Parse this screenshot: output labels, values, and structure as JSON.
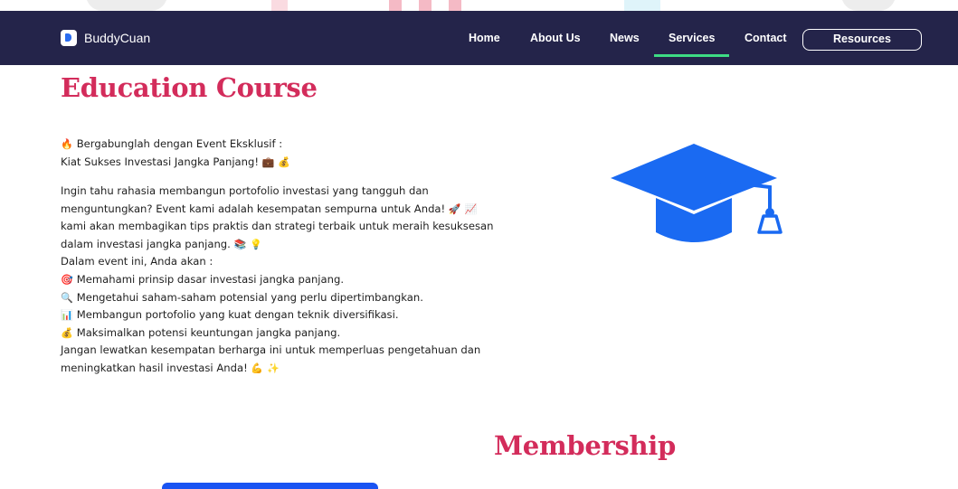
{
  "colors": {
    "nav_bg": "#24244a",
    "accent_pink": "#d32c5b",
    "active_underline": "#3ddc84",
    "cap_blue": "#1a6af2"
  },
  "brand": {
    "name": "BuddyCuan",
    "icon": "brand-logo-icon"
  },
  "nav": {
    "home": "Home",
    "about": "About Us",
    "news": "News",
    "services": "Services",
    "contact": "Contact",
    "resources": "Resources",
    "active": "Services"
  },
  "education": {
    "title": "Education Course",
    "intro_line1": "Bergabunglah dengan Event Eksklusif :",
    "intro_line2": "Kiat Sukses Investasi Jangka Panjang!",
    "body_line1": "Ingin tahu rahasia membangun portofolio investasi yang tangguh dan",
    "body_line2": "menguntungkan? Event kami adalah kesempatan sempurna untuk Anda!",
    "body_line3": "kami akan membagikan tips praktis dan strategi terbaik untuk meraih kesuksesan",
    "body_line4": "dalam investasi jangka panjang.",
    "body_line5": "Dalam event ini, Anda akan :",
    "point1": "Memahami prinsip dasar investasi jangka panjang.",
    "point2": "Mengetahui saham-saham potensial yang perlu dipertimbangkan.",
    "point3": "Membangun portofolio yang kuat dengan teknik diversifikasi.",
    "point4": "Maksimalkan potensi keuntungan jangka panjang.",
    "closing_line1": "Jangan lewatkan kesempatan berharga ini untuk memperluas pengetahuan dan",
    "closing_line2": "meningkatkan hasil investasi Anda!",
    "image_icon": "graduation-cap-icon"
  },
  "membership": {
    "title": "Membership"
  }
}
